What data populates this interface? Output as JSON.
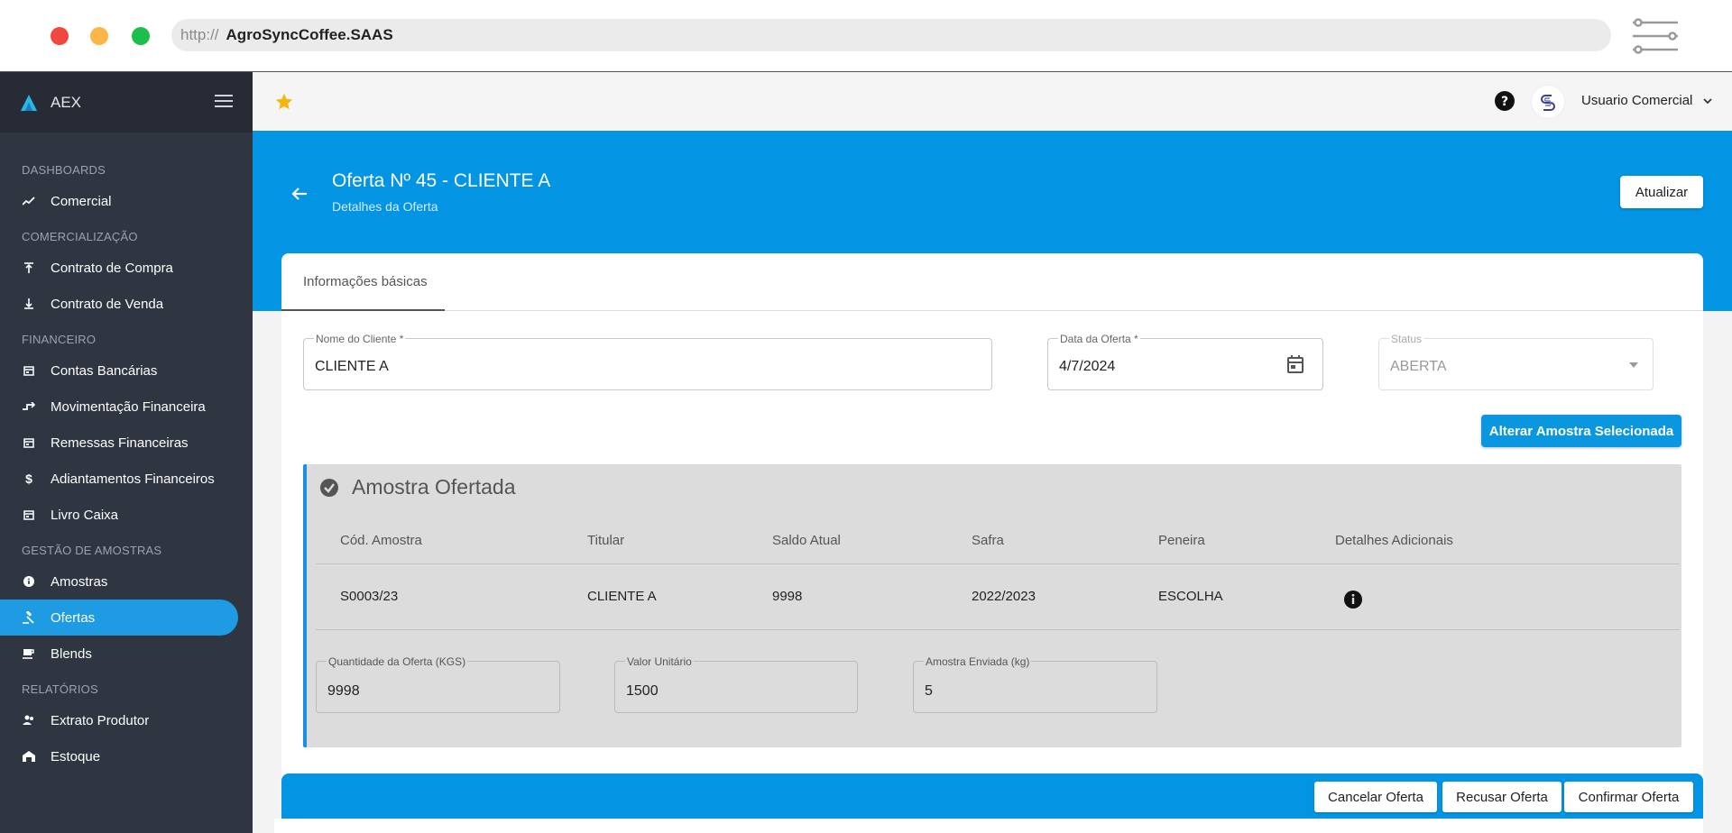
{
  "browser": {
    "protocol": "http://",
    "host": "AgroSyncCoffee.SAAS"
  },
  "sidebar": {
    "brand": "AEX",
    "sections": [
      {
        "title": "DASHBOARDS",
        "items": [
          {
            "label": "Comercial",
            "icon": "trending-icon"
          }
        ]
      },
      {
        "title": "COMERCIALIZAÇÃO",
        "items": [
          {
            "label": "Contrato de Compra",
            "icon": "upload-icon"
          },
          {
            "label": "Contrato de Venda",
            "icon": "download-icon"
          }
        ]
      },
      {
        "title": "FINANCEIRO",
        "items": [
          {
            "label": "Contas Bancárias",
            "icon": "calendar-icon"
          },
          {
            "label": "Movimentação Financeira",
            "icon": "transfer-icon"
          },
          {
            "label": "Remessas Financeiras",
            "icon": "calendar-icon"
          },
          {
            "label": "Adiantamentos Financeiros",
            "icon": "dollar-icon"
          },
          {
            "label": "Livro Caixa",
            "icon": "calendar-icon"
          }
        ]
      },
      {
        "title": "GESTÃO DE AMOSTRAS",
        "items": [
          {
            "label": "Amostras",
            "icon": "info-icon"
          },
          {
            "label": "Ofertas",
            "icon": "gavel-icon",
            "active": true
          },
          {
            "label": "Blends",
            "icon": "coffee-icon"
          }
        ]
      },
      {
        "title": "RELATÓRIOS",
        "items": [
          {
            "label": "Extrato Produtor",
            "icon": "people-icon"
          },
          {
            "label": "Estoque",
            "icon": "warehouse-icon"
          }
        ]
      }
    ]
  },
  "header": {
    "username": "Usuario Comercial"
  },
  "banner": {
    "title": "Oferta Nº 45 - CLIENTE A",
    "subtitle": "Detalhes da Oferta",
    "refresh_label": "Atualizar"
  },
  "tabs": [
    {
      "label": "Informações básicas"
    }
  ],
  "form": {
    "client": {
      "label": "Nome do Cliente *",
      "value": "CLIENTE A"
    },
    "date": {
      "label": "Data da Oferta *",
      "value": "4/7/2024"
    },
    "status": {
      "label": "Status",
      "value": "ABERTA"
    },
    "change_sample_label": "Alterar Amostra Selecionada"
  },
  "sample": {
    "title": "Amostra Ofertada",
    "columns": [
      "Cód. Amostra",
      "Titular",
      "Saldo Atual",
      "Safra",
      "Peneira",
      "Detalhes Adicionais"
    ],
    "row": [
      "S0003/23",
      "CLIENTE A",
      "9998",
      "2022/2023",
      "ESCOLHA"
    ],
    "quantity": {
      "label": "Quantidade da Oferta (KGS)",
      "value": "9998"
    },
    "unit_value": {
      "label": "Valor Unitário",
      "value": "1500"
    },
    "sent": {
      "label": "Amostra Enviada (kg)",
      "value": "5"
    }
  },
  "footer": {
    "cancel_label": "Cancelar Oferta",
    "refuse_label": "Recusar Oferta",
    "confirm_label": "Confirmar Oferta"
  },
  "colors": {
    "primary": "#0395e3",
    "sidebar": "#2f3541",
    "active": "#1e9be3",
    "star": "#f5b50c"
  }
}
